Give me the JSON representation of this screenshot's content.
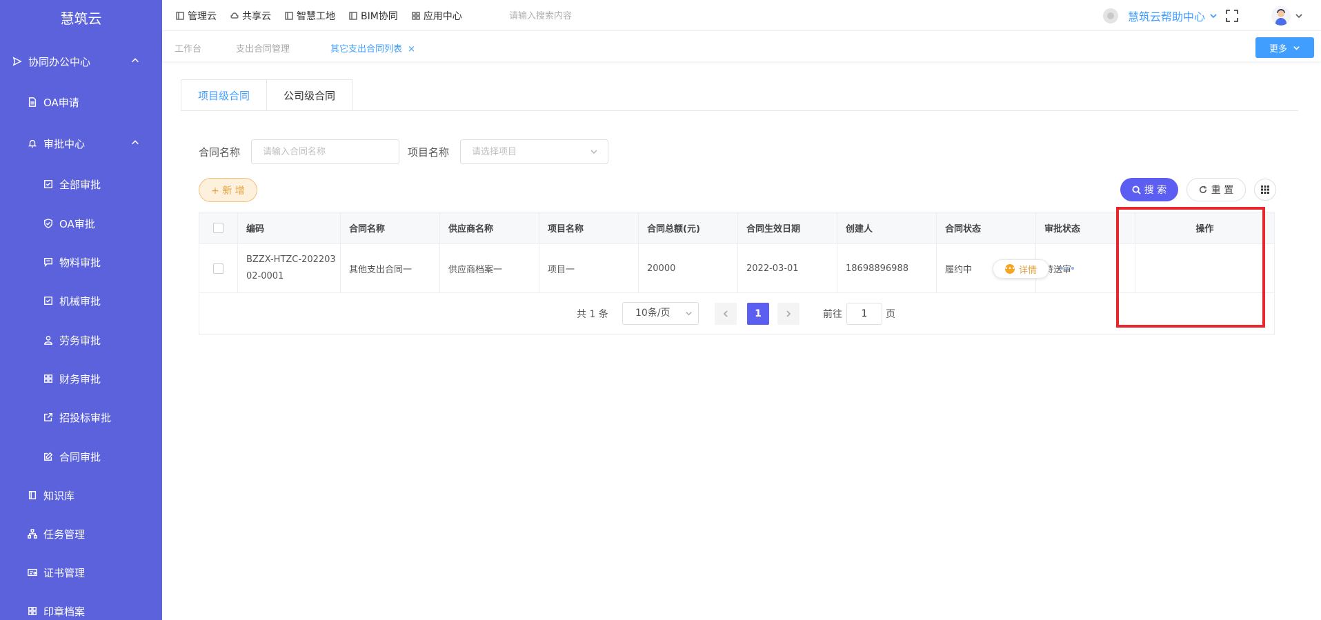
{
  "app": {
    "brand": "慧筑云"
  },
  "sidebar": {
    "items": [
      {
        "label": "协同办公中心",
        "icon": "send-icon",
        "expandable": true
      },
      {
        "label": "OA申请",
        "icon": "document-icon"
      },
      {
        "label": "审批中心",
        "icon": "bell-icon",
        "expandable": true
      },
      {
        "label": "全部审批",
        "icon": "checkbox-icon"
      },
      {
        "label": "OA审批",
        "icon": "shield-check-icon"
      },
      {
        "label": "物料审批",
        "icon": "message-icon"
      },
      {
        "label": "机械审批",
        "icon": "checkbox-icon"
      },
      {
        "label": "劳务审批",
        "icon": "user-icon"
      },
      {
        "label": "财务审批",
        "icon": "grid-icon"
      },
      {
        "label": "招投标审批",
        "icon": "external-link-icon"
      },
      {
        "label": "合同审批",
        "icon": "edit-icon"
      },
      {
        "label": "知识库",
        "icon": "book-icon"
      },
      {
        "label": "任务管理",
        "icon": "org-chart-icon"
      },
      {
        "label": "证书管理",
        "icon": "certificate-icon"
      },
      {
        "label": "印章档案",
        "icon": "grid-icon"
      }
    ]
  },
  "topbar": {
    "nav": [
      {
        "label": "管理云",
        "icon": "panel-icon"
      },
      {
        "label": "共享云",
        "icon": "cloud-icon"
      },
      {
        "label": "智慧工地",
        "icon": "panel-icon"
      },
      {
        "label": "BIM协同",
        "icon": "panel-icon"
      },
      {
        "label": "应用中心",
        "icon": "grid-icon"
      }
    ],
    "search_placeholder": "请输入搜索内容",
    "help_label": "慧筑云帮助中心"
  },
  "pagetabs": {
    "tabs": [
      {
        "label": "工作台"
      },
      {
        "label": "支出合同管理"
      },
      {
        "label": "其它支出合同列表",
        "active": true
      }
    ],
    "close": "×",
    "more_label": "更多"
  },
  "content_tabs": [
    {
      "label": "项目级合同",
      "active": true
    },
    {
      "label": "公司级合同"
    }
  ],
  "filters": {
    "contract_name_label": "合同名称",
    "contract_name_placeholder": "请输入合同名称",
    "project_name_label": "项目名称",
    "project_name_placeholder": "请选择项目"
  },
  "actions": {
    "add_label": "+ 新 增",
    "search_label": "搜 索",
    "reset_label": "重 置"
  },
  "table": {
    "headers": [
      "编码",
      "合同名称",
      "供应商名称",
      "项目名称",
      "合同总额(元)",
      "合同生效日期",
      "创建人",
      "合同状态",
      "审批状态",
      "操作"
    ],
    "rows": [
      {
        "code": "BZZX-HTZC-20220302-0001",
        "name": "其他支出合同一",
        "supplier": "供应商档案一",
        "project": "项目一",
        "amount": "20000",
        "date": "2022-03-01",
        "creator": "18698896988",
        "contract_status": "履约中",
        "approval_status": "待送审",
        "detail_label": "详情"
      }
    ]
  },
  "pagination": {
    "total": "共 1 条",
    "page_size": "10条/页",
    "current_page": "1",
    "goto_prefix": "前往",
    "goto_value": "1",
    "goto_suffix": "页"
  },
  "colors": {
    "sidebar_bg": "#5b62dc",
    "primary": "#409eff",
    "accent": "#5b5ef0",
    "warning": "#e6a23c",
    "highlight": "#e8262c"
  }
}
